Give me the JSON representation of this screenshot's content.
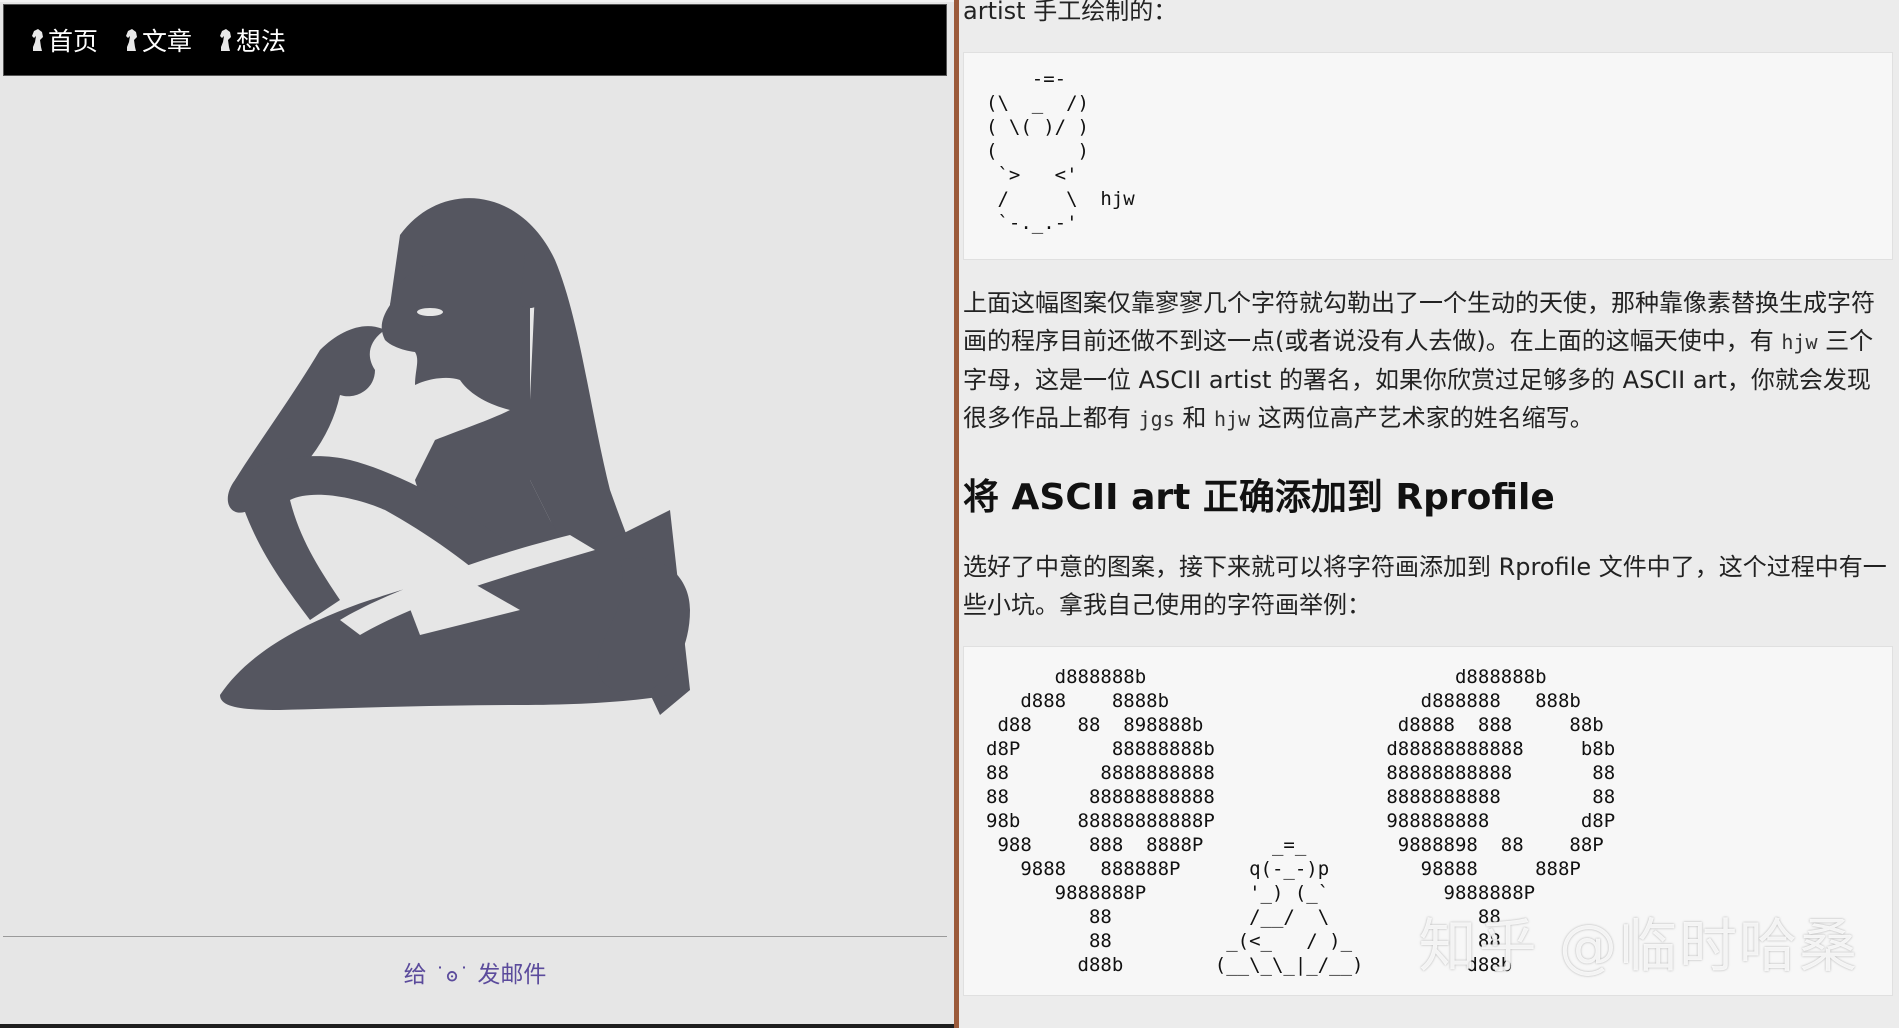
{
  "left": {
    "nav": [
      {
        "label": "首页"
      },
      {
        "label": "文章"
      },
      {
        "label": "想法"
      }
    ],
    "footer": {
      "prefix": "给 ",
      "face": "˙ʘ˙",
      "suffix": " 发邮件"
    }
  },
  "right": {
    "top_text": "artist 手工绘制的：",
    "angel_art": "    -=-\n(\\  _  /)\n( \\( )/ )\n(       )\n `>   <'\n /     \\  hjw\n `-._.-'",
    "para1": {
      "t1": "上面这幅图案仅靠寥寥几个字符就勾勒出了一个生动的天使，那种靠像素替换生成字符画的程序目前还做不到这一点(或者说没有人去做)。在上面的这幅天使中，有 ",
      "c1": "hjw",
      "t2": " 三个字母，这是一位 ASCII artist 的署名，如果你欣赏过足够多的 ASCII art，你就会发现很多作品上都有 ",
      "c2": "jgs",
      "t3": " 和 ",
      "c3": "hjw",
      "t4": " 这两位高产艺术家的姓名缩写。"
    },
    "heading": "将 ASCII art 正确添加到 Rprofile",
    "para2": "选好了中意的图案，接下来就可以将字符画添加到 Rprofile 文件中了，这个过程中有一些小坑。拿我自己使用的字符画举例：",
    "yinyang_art": "      d888888b                           d888888b\n   d888    8888b                      d888888   888b\n d88    88  898888b                 d8888  888     88b\nd8P        88888888b               d88888888888     b8b\n88        8888888888               88888888888       88\n88       88888888888               8888888888        88\n98b     88888888888P               988888888        d8P\n 988     888  8888P      _=_        9888898  88    88P\n   9888   888888P      q(-_-)p        98888     888P\n      9888888P         '_) (_`          9888888P\n         88            /__/  \\             88\n         88          _(<_   / )_           88\n        d88b        (__\\_\\_|_/__)         d88b"
  },
  "watermark": "知乎 @临时哈桑",
  "colors": {
    "nav_bg": "#000000",
    "figure": "#555660",
    "link": "#5b4b9c",
    "divider": "#9b5a3a"
  }
}
